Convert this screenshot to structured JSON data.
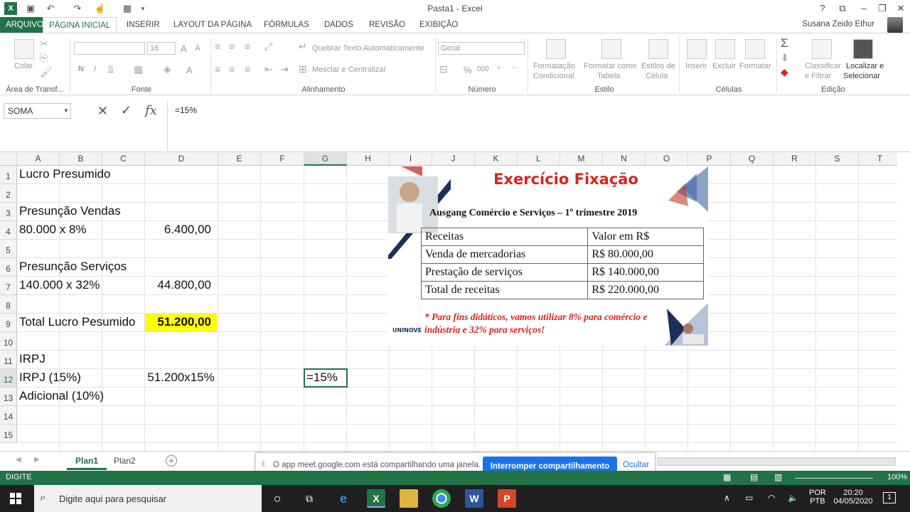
{
  "titlebar": {
    "title": "Pasta1 - Excel",
    "help": "?"
  },
  "tabs": [
    "ARQUIVO",
    "PÁGINA INICIAL",
    "INSERIR",
    "LAYOUT DA PÁGINA",
    "FÓRMULAS",
    "DADOS",
    "REVISÃO",
    "EXIBIÇÃO"
  ],
  "user": "Susana Zeido Ethur",
  "ribbon": {
    "clipboard": {
      "paste": "Colar",
      "group": "Área de Transf..."
    },
    "font": {
      "size": "16",
      "bold": "N",
      "italic": "I",
      "underline": "S",
      "grow": "A",
      "shrink": "A",
      "color": "A",
      "group": "Fonte"
    },
    "alignment": {
      "wrap": "Quebrar Texto Automaticamente",
      "merge": "Mesclar e Centralizar",
      "group": "Alinhamento"
    },
    "number": {
      "format": "Geral",
      "percent": "%",
      "thousands": "000",
      "group": "Número"
    },
    "styles": {
      "cond1": "Formatação",
      "cond2": "Condicional",
      "table1": "Formatar como",
      "table2": "Tabela",
      "cell1": "Estilos de",
      "cell2": "Célula",
      "group": "Estilo"
    },
    "cells": {
      "insert": "Inserir",
      "delete": "Excluir",
      "format": "Formatar",
      "group": "Células"
    },
    "editing": {
      "sort1": "Classificar",
      "sort2": "e Filtrar",
      "find1": "Localizar e",
      "find2": "Selecionar",
      "group": "Edição"
    }
  },
  "formula": {
    "namebox": "SOMA",
    "value": "=15%",
    "fx": "fx"
  },
  "columns": [
    "A",
    "B",
    "C",
    "D",
    "E",
    "F",
    "G",
    "H",
    "I",
    "J",
    "K",
    "L",
    "M",
    "N",
    "O",
    "P",
    "Q",
    "R",
    "S",
    "T"
  ],
  "rows": [
    "1",
    "2",
    "3",
    "4",
    "5",
    "6",
    "7",
    "8",
    "9",
    "10",
    "11",
    "12",
    "13",
    "14",
    "15"
  ],
  "cells": {
    "A1": "Lucro Presumido",
    "A3": "Presunção Vendas",
    "A4": "80.000 x 8%",
    "D4": "6.400,00",
    "A6": "Presunção Serviços",
    "A7": "140.000 x 32%",
    "D7": "44.800,00",
    "A9": "Total Lucro Pesumido",
    "D9": "51.200,00",
    "A11": "IRPJ",
    "A12": "IRPJ (15%)",
    "D12": "51.200x15%",
    "G12": "=15%",
    "A13": "Adicional (10%)"
  },
  "slide": {
    "title": "Exercício Fixação",
    "subtitle": "Ausgang Comércio e Serviços – 1º trimestre 2019",
    "table": [
      [
        "Receitas",
        "Valor em R$"
      ],
      [
        "Venda de mercadorias",
        "R$ 80.000,00"
      ],
      [
        "Prestação de serviços",
        "R$ 140.000,00"
      ],
      [
        "Total de receitas",
        "R$ 220.000,00"
      ]
    ],
    "note": "* Para fins didáticos, vamos utilizar 8% para comércio e indústria e 32% para serviços!",
    "logo": "UNINOVE"
  },
  "sheets": [
    "Plan1",
    "Plan2"
  ],
  "share": {
    "text": "O app meet.google.com está compartilhando uma janela.",
    "button": "Interromper compartilhamento",
    "hide": "Ocultar"
  },
  "status": {
    "mode": "DIGITE",
    "zoom": "100%"
  },
  "taskbar": {
    "search": "Digite aqui para pesquisar",
    "lang1": "POR",
    "lang2": "PTB",
    "time": "20:20",
    "date": "04/05/2020",
    "notif": "1"
  },
  "colors": {
    "excel_green": "#217346",
    "highlight": "#ffff00",
    "red": "#d9241c",
    "blue": "#1a73e8"
  }
}
